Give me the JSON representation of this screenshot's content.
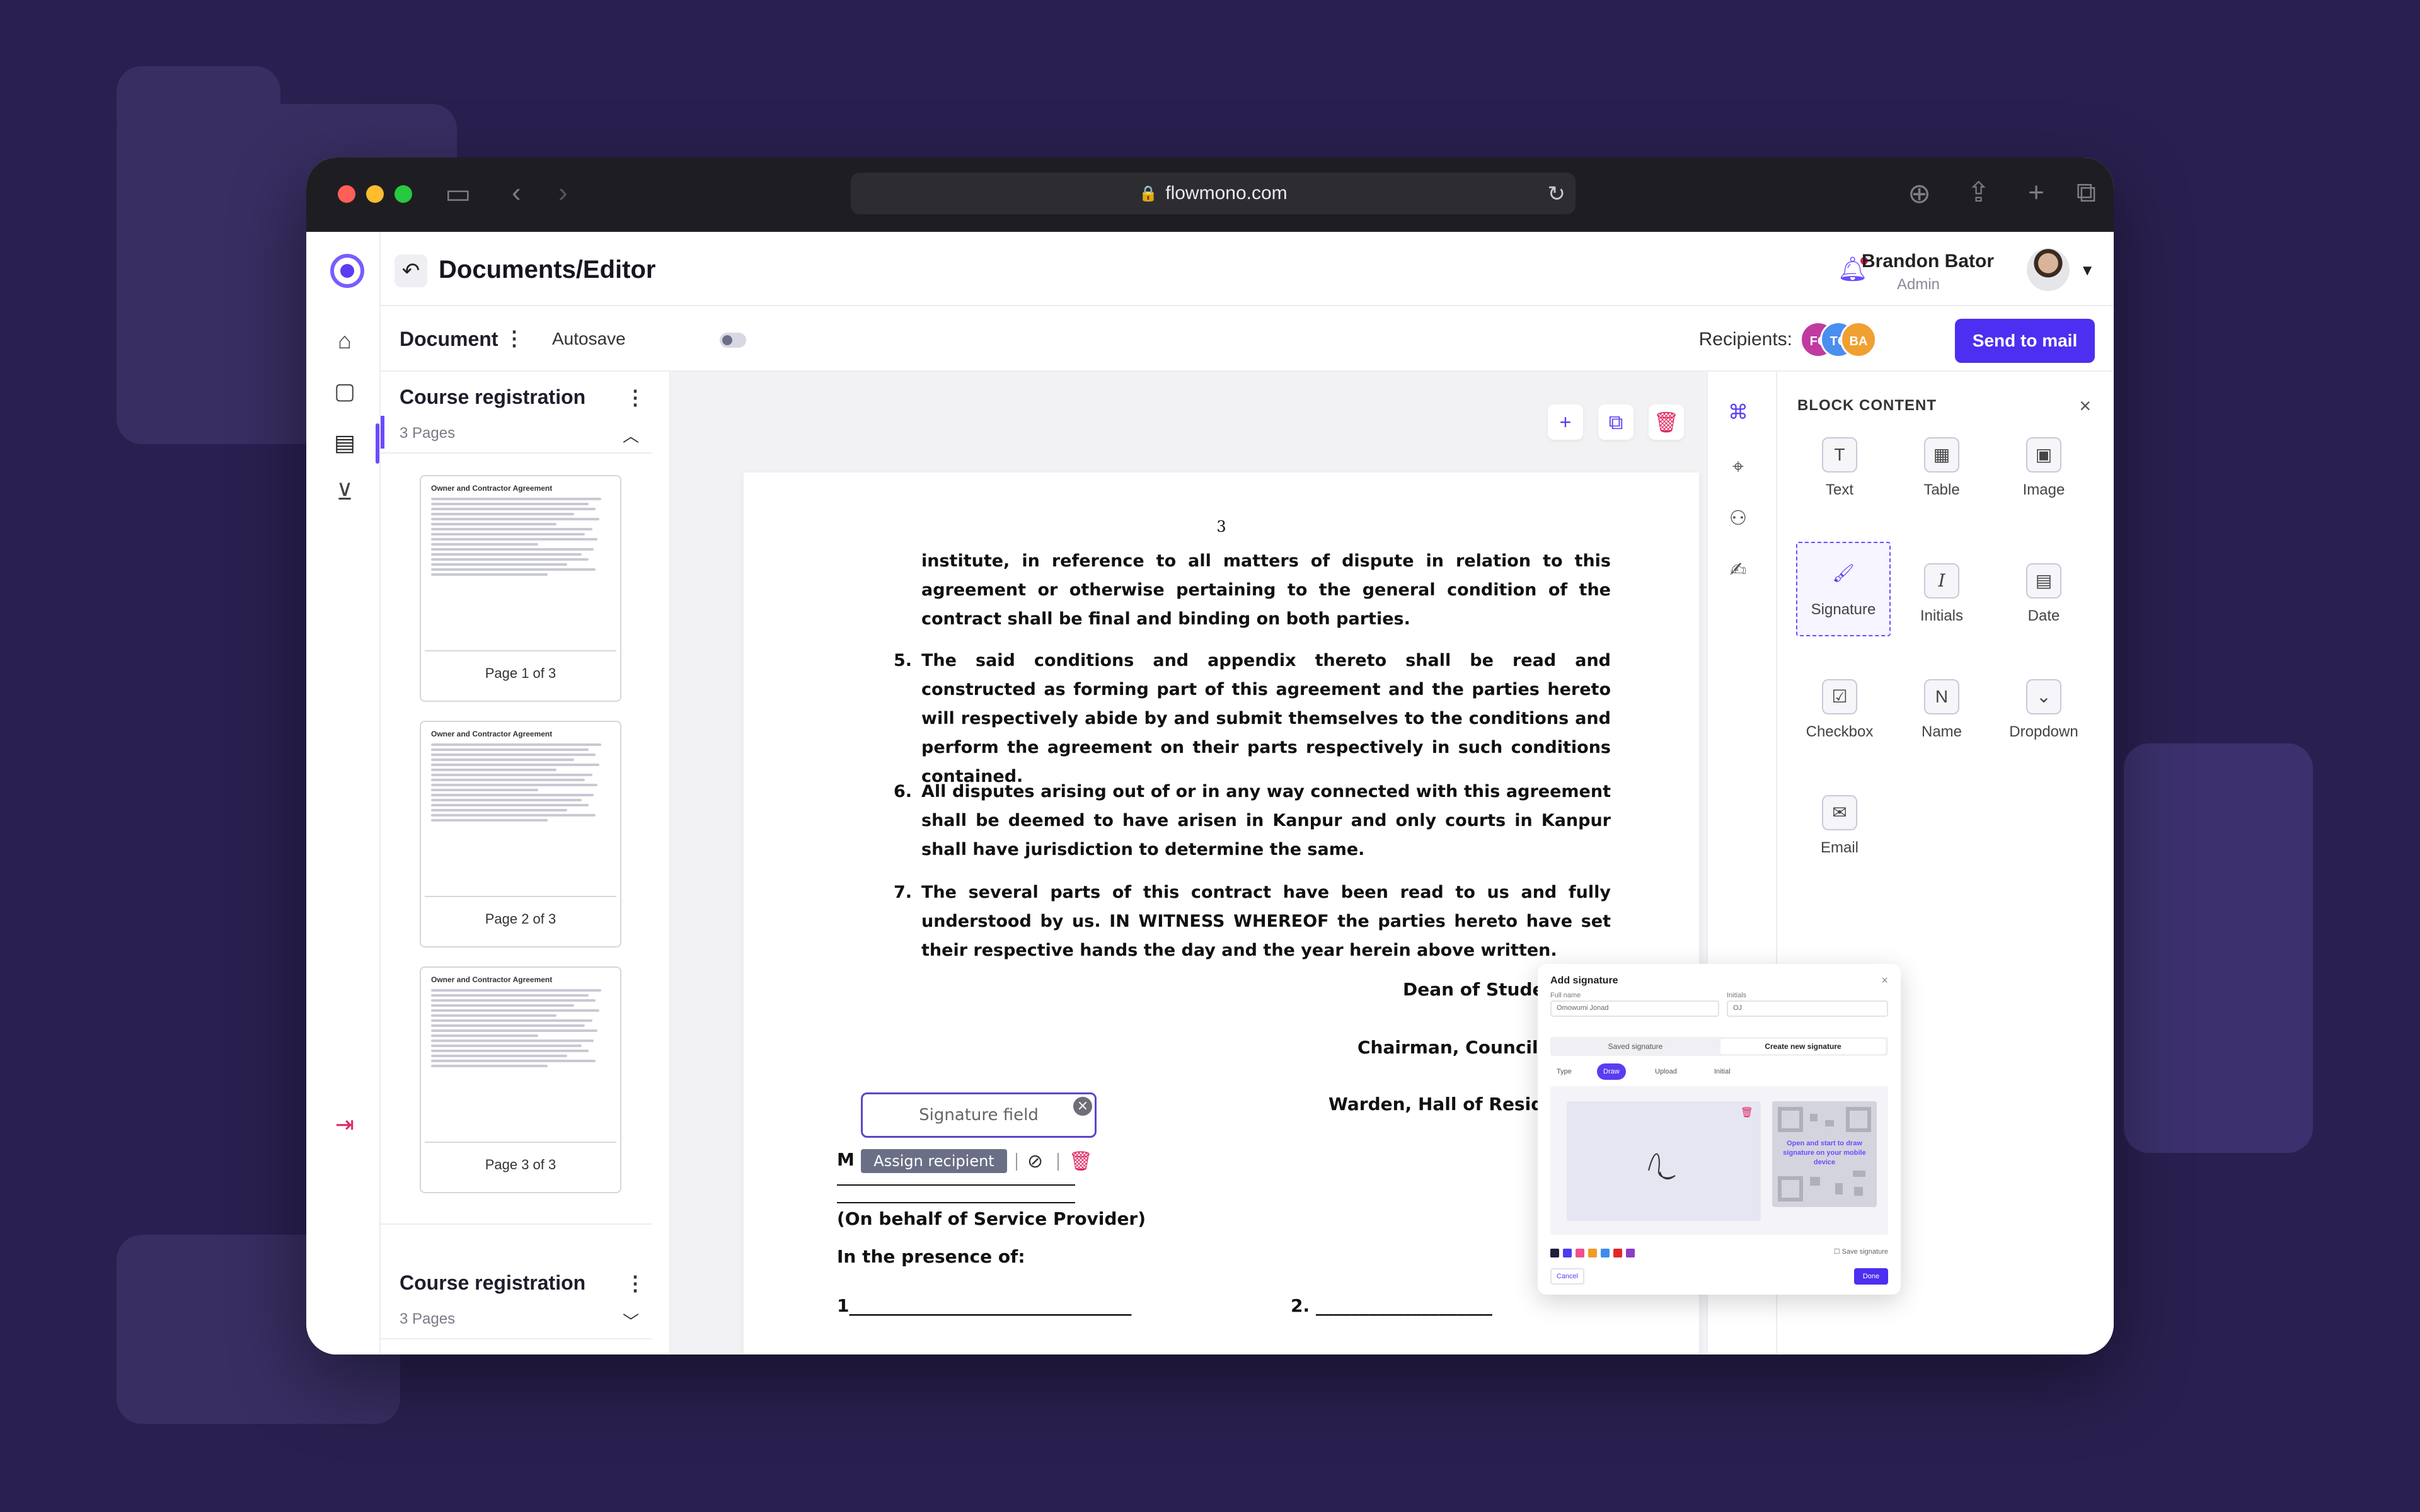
{
  "browser": {
    "url": "flowmono.com"
  },
  "header": {
    "title": "Documents/Editor",
    "user_name": "Brandon Bator",
    "user_role": "Admin"
  },
  "toolbar": {
    "document_label": "Document",
    "autosave_label": "Autosave",
    "autosave_on": false,
    "recipients_label": "Recipients:",
    "recipients": [
      {
        "initials": "FC",
        "color": "#c03aa0"
      },
      {
        "initials": "TC",
        "color": "#4a8ef0"
      },
      {
        "initials": "BA",
        "color": "#f0a030"
      }
    ],
    "send_label": "Send to mail"
  },
  "pages_panel": {
    "groups": [
      {
        "title": "Course registration",
        "subtitle": "3 Pages"
      },
      {
        "title": "Course registration",
        "subtitle": "3 Pages"
      }
    ],
    "thumbs": [
      {
        "caption": "Page 1 of 3",
        "heading": "Owner and Contractor Agreement"
      },
      {
        "caption": "Page 2 of 3",
        "heading": "Owner and Contractor Agreement"
      },
      {
        "caption": "Page 3 of 3",
        "heading": "Owner and Contractor Agreement"
      }
    ]
  },
  "document": {
    "page_number": "3",
    "para_intro": "institute, in reference to all matters of dispute in relation to this agreement or otherwise pertaining to the general condition of the contract shall be final and binding on both parties.",
    "items": [
      {
        "num": "5.",
        "text": "The said conditions and appendix thereto shall be read and constructed as forming part of this agreement and the parties hereto will respectively abide by and submit themselves to the conditions and perform the agreement on their parts respectively in such conditions contained."
      },
      {
        "num": "6.",
        "text": "All disputes arising out of or in any way connected with this agreement shall be deemed to have arisen in Kanpur and only courts in Kanpur shall have jurisdiction to determine the same."
      },
      {
        "num": "7.",
        "text": "The several parts of this contract have been read to us and fully understood by us. IN WITNESS WHEREOF the parties hereto have set their respective hands the day and the year herein above written."
      }
    ],
    "sign_dean": "Dean of Student",
    "sign_chairman": "Chairman, Council of",
    "sign_warden": "Warden, Hall of Residenc",
    "m_letter": "M",
    "behalf": "(On behalf of Service Provider)",
    "presence": "In the presence of:",
    "witness_1": "1________________________________",
    "witness_2": "2. ____________________"
  },
  "signature_field": {
    "placeholder": "Signature field",
    "assign_label": "Assign recipient"
  },
  "add_signature": {
    "title": "Add signature",
    "full_name_label": "Full name",
    "full_name_value": "Omowumi Jonad",
    "initials_label": "Initials",
    "initials_value": "OJ",
    "tab_saved": "Saved signature",
    "tab_create": "Create new signature",
    "mode_type": "Type",
    "mode_draw": "Draw",
    "mode_upload": "Upload",
    "mode_initial": "Initial",
    "qr_text": "Open and start to draw signature on your mobile device",
    "save_label": "Save signature",
    "cancel_label": "Cancel",
    "done_label": "Done",
    "colors": [
      "#1e1e3c",
      "#4b3cf0",
      "#f0508c",
      "#f09c28",
      "#3c8cf0",
      "#e02828",
      "#8c3cc8"
    ]
  },
  "block_panel": {
    "title": "BLOCK CONTENT",
    "blocks": [
      {
        "label": "Text",
        "icon": "text-icon"
      },
      {
        "label": "Table",
        "icon": "table-icon"
      },
      {
        "label": "Image",
        "icon": "image-icon"
      },
      {
        "label": "Signature",
        "icon": "signature-icon"
      },
      {
        "label": "Initials",
        "icon": "initials-icon"
      },
      {
        "label": "Date",
        "icon": "date-icon"
      },
      {
        "label": "Checkbox",
        "icon": "checkbox-icon"
      },
      {
        "label": "Name",
        "icon": "name-icon"
      },
      {
        "label": "Dropdown",
        "icon": "dropdown-icon"
      },
      {
        "label": "Email",
        "icon": "email-icon"
      }
    ]
  }
}
